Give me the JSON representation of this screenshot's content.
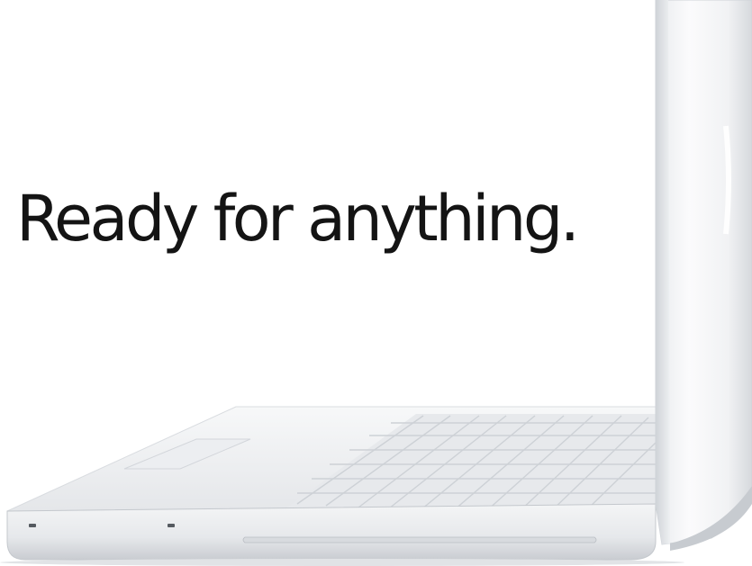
{
  "headline": {
    "text": "Ready for anything."
  },
  "colors": {
    "background": "#ffffff",
    "headline": "#141414",
    "laptop_body": "#f2f3f5",
    "laptop_shadow": "#c9ccd1"
  }
}
